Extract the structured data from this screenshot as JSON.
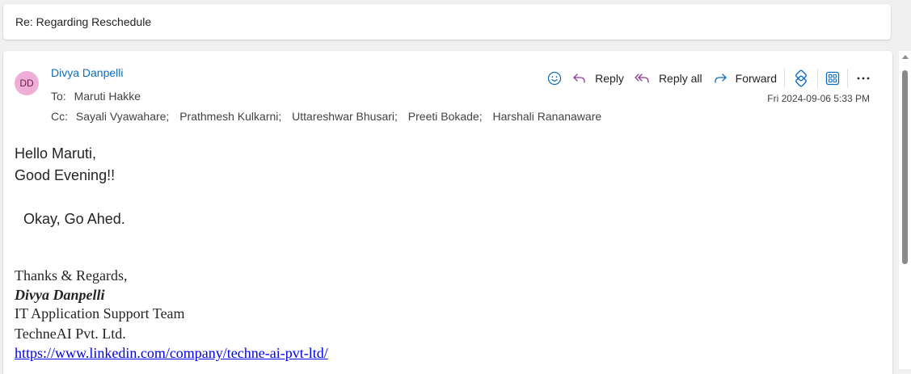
{
  "subject": "Re: Regarding Reschedule",
  "sender": {
    "initials": "DD",
    "name": "Divya Danpelli",
    "avatar_color": "#eeaed6"
  },
  "to": {
    "label": "To:",
    "recipients": [
      "Maruti Hakke"
    ]
  },
  "cc": {
    "label": "Cc:",
    "recipients": [
      "Sayali Vyawahare",
      "Prathmesh Kulkarni",
      "Uttareshwar Bhusari",
      "Preeti Bokade",
      "Harshali Rananaware"
    ],
    "separator": ";"
  },
  "timestamp": "Fri 2024-09-06 5:33 PM",
  "actions": {
    "reply": "Reply",
    "reply_all": "Reply all",
    "forward": "Forward"
  },
  "body": {
    "greeting": "Hello Maruti,",
    "greeting2": "Good Evening!!",
    "message": "Okay, Go Ahed.",
    "closing": "Thanks & Regards,",
    "sig_name": "Divya Danpelli",
    "sig_team": "IT Application Support Team",
    "sig_company": "TechneAI Pvt. Ltd.",
    "sig_link": "https://www.linkedin.com/company/techne-ai-pvt-ltd/"
  },
  "colors": {
    "accent": "#0f6cbd",
    "reply_icon": "#8f3a8f",
    "link": "#0000ee"
  }
}
